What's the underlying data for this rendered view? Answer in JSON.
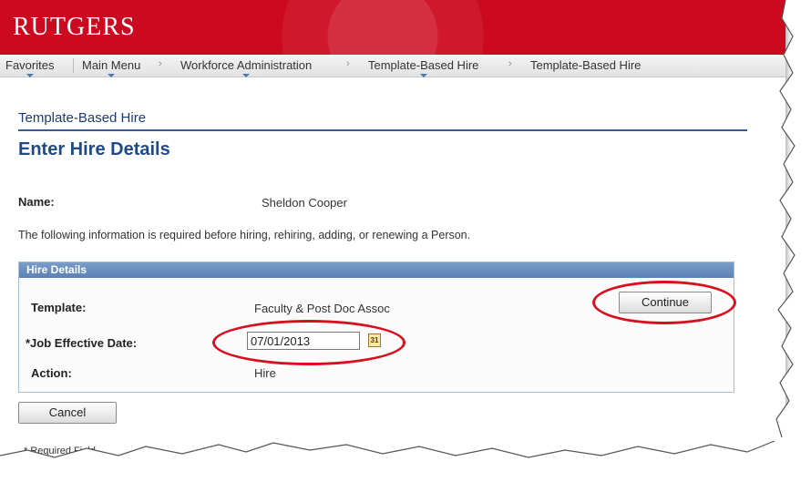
{
  "header": {
    "logo_text": "RUTGERS"
  },
  "nav": {
    "favorites": "Favorites",
    "main_menu": "Main Menu",
    "workforce_admin": "Workforce Administration",
    "template_hire_1": "Template-Based Hire",
    "template_hire_2": "Template-Based Hire",
    "separator": "›"
  },
  "page": {
    "component_title": "Template-Based Hire",
    "title": "Enter Hire Details",
    "name_label": "Name:",
    "name_value": "Sheldon Cooper",
    "info_text": "The following information is required before hiring, rehiring, adding, or renewing a Person."
  },
  "hire_details": {
    "header": "Hire Details",
    "template_label": "Template:",
    "template_value": "Faculty & Post Doc Assoc",
    "date_label": "*Job Effective Date:",
    "date_value": "07/01/2013",
    "action_label": "Action:",
    "action_value": "Hire",
    "continue_label": "Continue"
  },
  "footer": {
    "cancel_label": "Cancel",
    "required_note": "* Required Field"
  },
  "colors": {
    "brand_red": "#cc0a1f",
    "title_blue": "#1f4a88",
    "highlight_red": "#d80f1f"
  },
  "icons": {
    "calendar": "calendar-icon",
    "dropdown": "chevron-down-icon"
  }
}
